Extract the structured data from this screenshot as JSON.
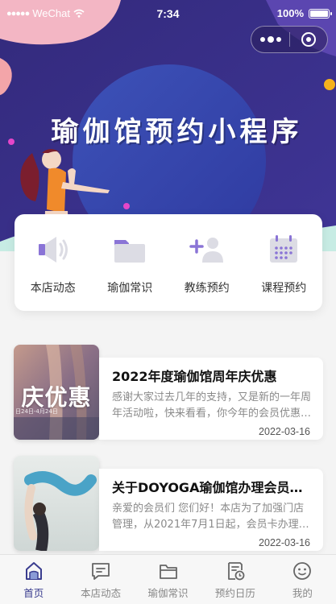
{
  "status_bar": {
    "carrier": "WeChat",
    "time": "7:34",
    "battery": "100%",
    "battery_level": 1.0
  },
  "banner": {
    "title": "瑜伽馆预约小程序"
  },
  "quick_menu": {
    "items": [
      {
        "label": "本店动态",
        "icon": "speaker-icon"
      },
      {
        "label": "瑜伽常识",
        "icon": "folder-icon"
      },
      {
        "label": "教练预约",
        "icon": "add-user-icon"
      },
      {
        "label": "课程预约",
        "icon": "calendar-icon"
      }
    ]
  },
  "articles": [
    {
      "title": "2022年度瑜伽馆周年庆优惠",
      "description": "感谢大家过去几年的支持，又是新的一年周年活动啦，快来看看，你今年的会员优惠活动吧",
      "date": "2022-03-16",
      "thumb_text": "庆优惠",
      "thumb_small": "日24日-4月24日"
    },
    {
      "title": "关于DOYOGA瑜伽馆办理会员卡的通知",
      "description": "亲爱的会员们 您们好！本店为了加强门店管理，从2021年7月1日起，会员卡办理需要实名",
      "date": "2022-03-16"
    }
  ],
  "tab_bar": {
    "items": [
      {
        "label": "首页",
        "icon": "home-icon",
        "active": true
      },
      {
        "label": "本店动态",
        "icon": "message-icon",
        "active": false
      },
      {
        "label": "瑜伽常识",
        "icon": "folder-icon",
        "active": false
      },
      {
        "label": "预约日历",
        "icon": "calendar-clock-icon",
        "active": false
      },
      {
        "label": "我的",
        "icon": "face-icon",
        "active": false
      }
    ]
  },
  "colors": {
    "banner_bg": "#3b2f86",
    "accent": "#3a3d8f",
    "icon_purple": "#8a74d6",
    "icon_gray": "#dcdce4"
  }
}
